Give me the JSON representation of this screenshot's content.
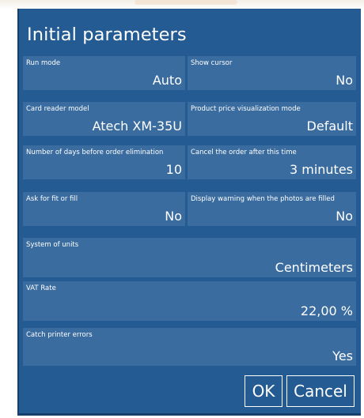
{
  "dialog": {
    "title": "Initial parameters",
    "fields": [
      {
        "label": "Run mode",
        "value": "Auto"
      },
      {
        "label": "Show cursor",
        "value": "No"
      },
      {
        "label": "Card reader model",
        "value": "Atech XM-35U"
      },
      {
        "label": "Product price visualization mode",
        "value": "Default"
      },
      {
        "label": "Number of days before order elimination",
        "value": "10"
      },
      {
        "label": "Cancel the order after this time",
        "value": "3 minutes"
      },
      {
        "label": "Ask for fit or fill",
        "value": "No"
      },
      {
        "label": "Display warning when the photos are filled",
        "value": "No"
      },
      {
        "label": "System of units",
        "value": "Centimeters"
      },
      {
        "label": "VAT Rate",
        "value": "22,00 %"
      },
      {
        "label": "Catch printer errors",
        "value": "Yes"
      }
    ],
    "buttons": {
      "ok": "OK",
      "cancel": "Cancel"
    }
  },
  "colors": {
    "dialog_bg": "#245b93",
    "field_bg": "#3a6c9f",
    "text": "#ffffff"
  }
}
